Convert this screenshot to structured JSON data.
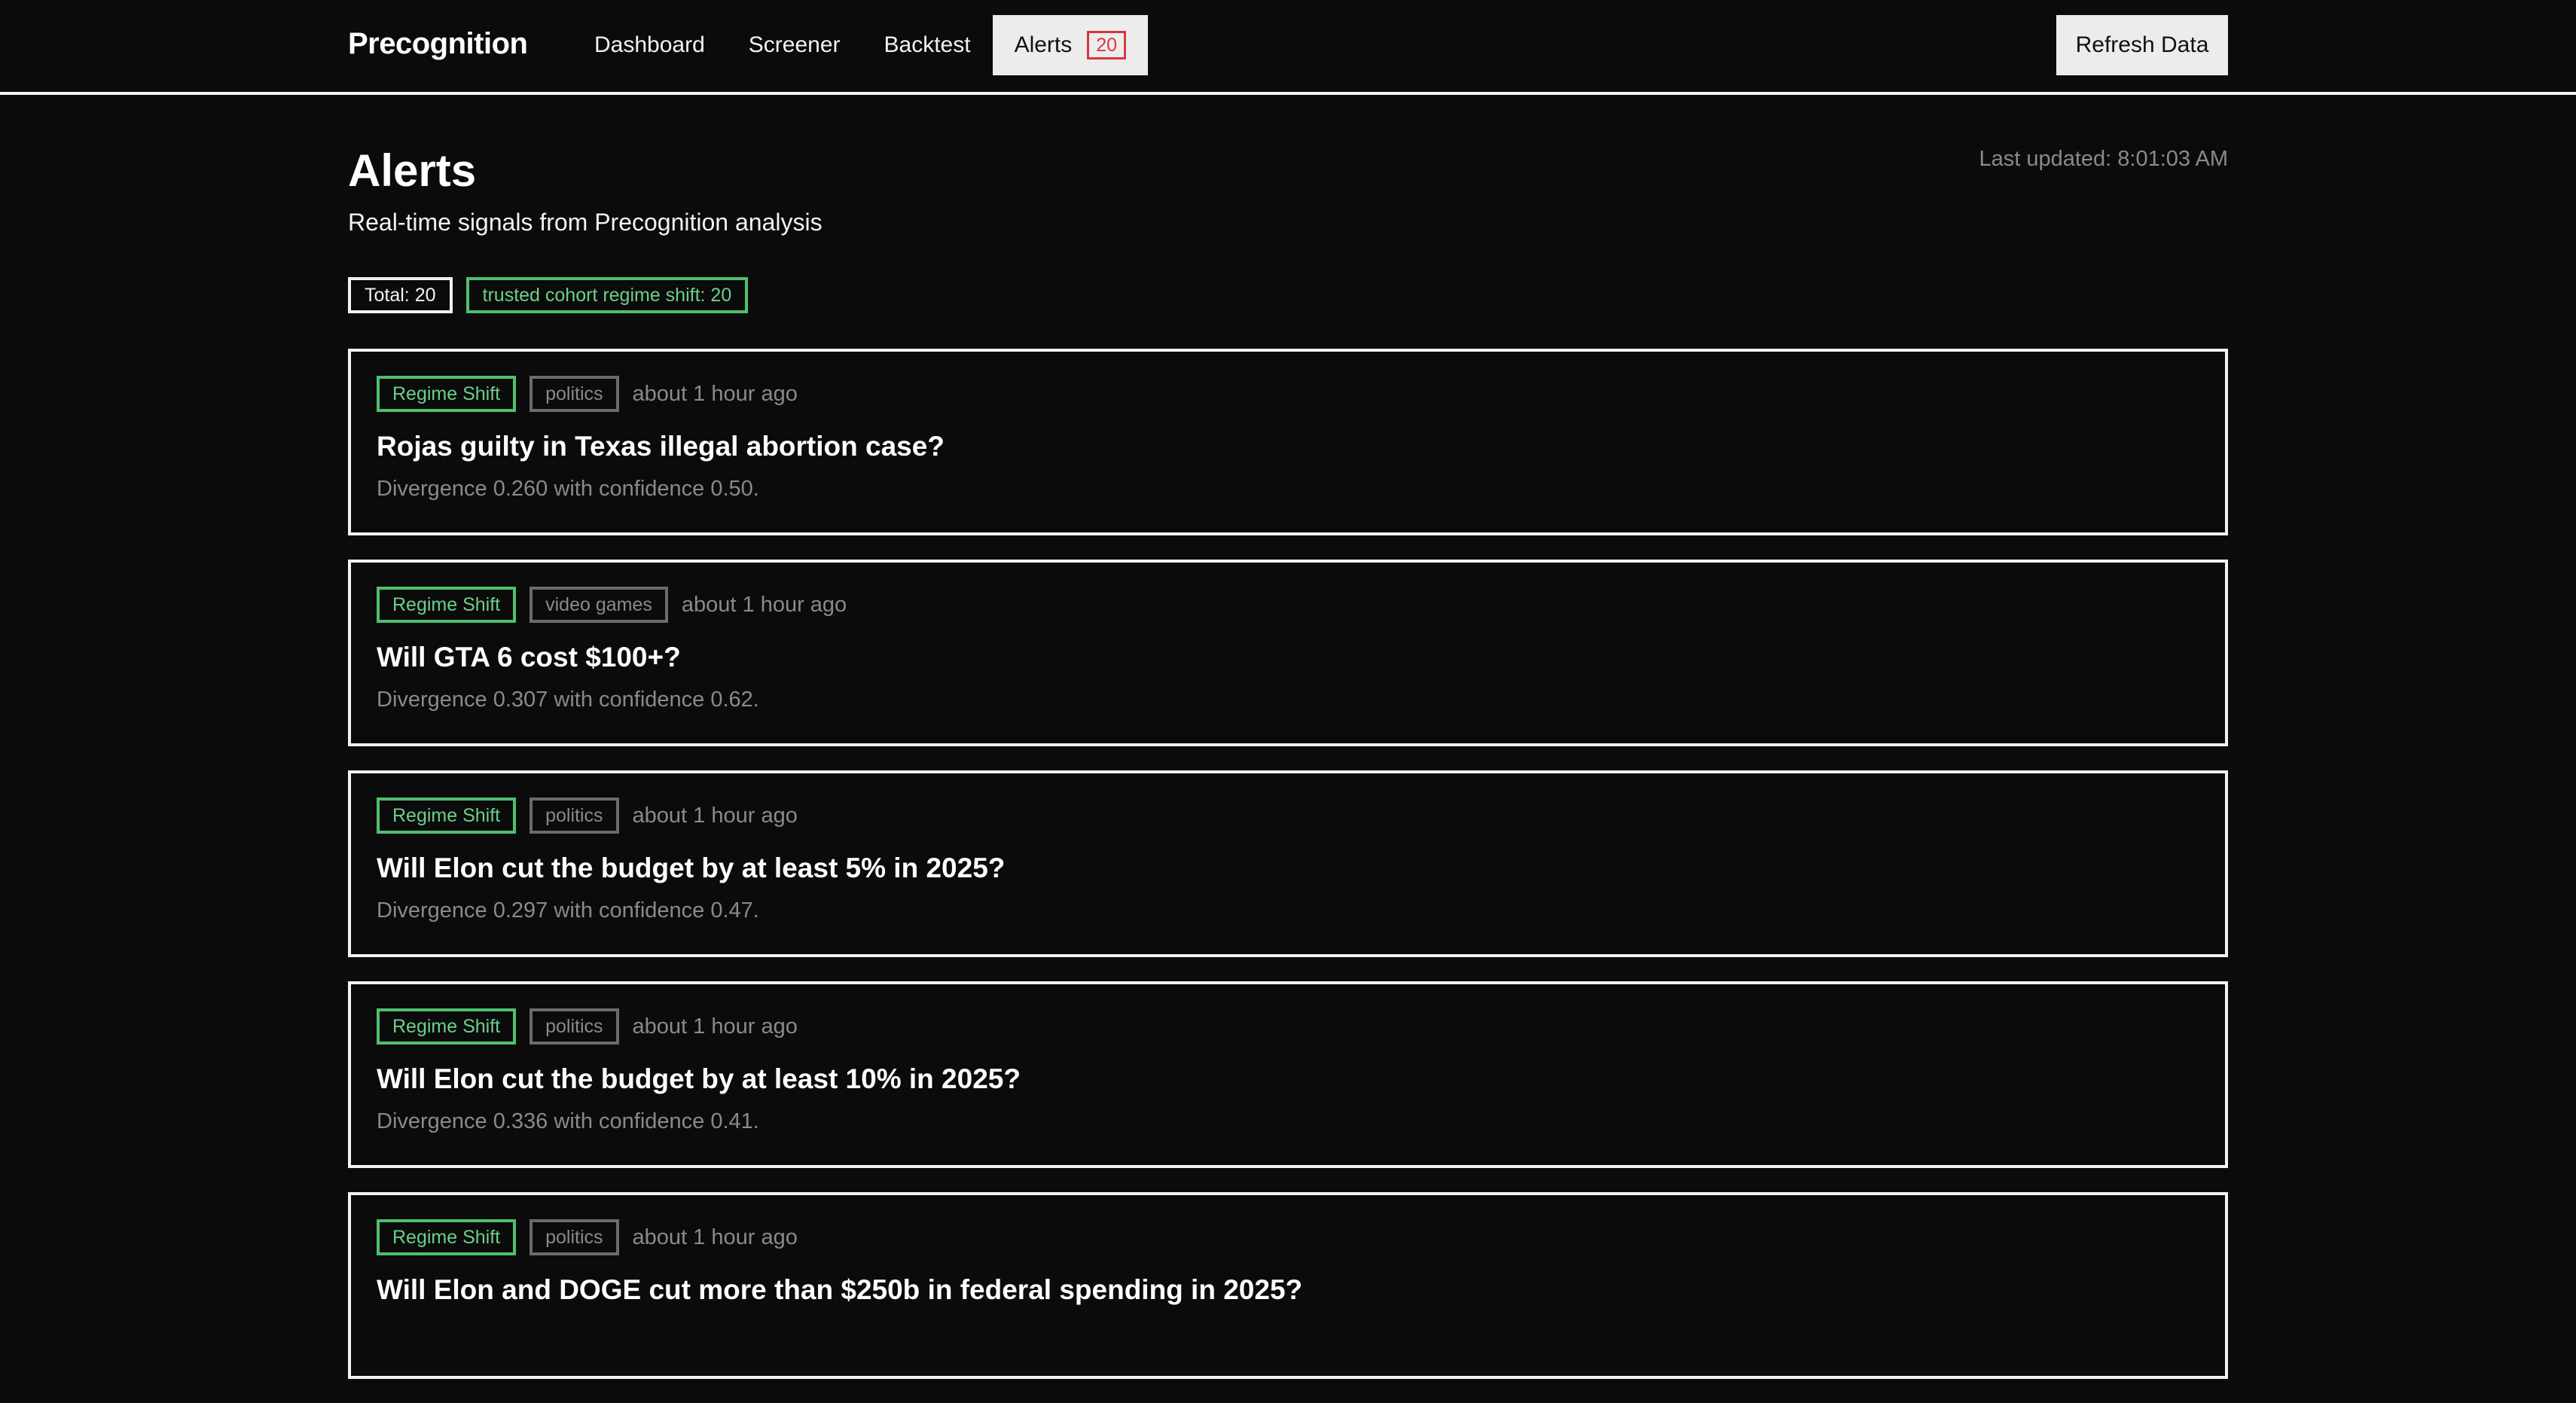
{
  "brand": "Precognition",
  "nav": {
    "items": [
      "Dashboard",
      "Screener",
      "Backtest",
      "Alerts"
    ],
    "alerts_badge": "20"
  },
  "refresh_label": "Refresh Data",
  "page": {
    "title": "Alerts",
    "subtitle": "Real-time signals from Precognition analysis",
    "last_updated": "Last updated: 8:01:03 AM"
  },
  "summary": {
    "total": "Total: 20",
    "regime": "trusted cohort regime shift: 20"
  },
  "colors": {
    "background": "#0b0b0b",
    "accent_green": "#4fbf6e",
    "badge_red": "#d9373d"
  },
  "alerts": [
    {
      "type": "Regime Shift",
      "category": "politics",
      "time": "about 1 hour ago",
      "title": "Rojas guilty in Texas illegal abortion case?",
      "desc": "Divergence 0.260 with confidence 0.50."
    },
    {
      "type": "Regime Shift",
      "category": "video games",
      "time": "about 1 hour ago",
      "title": "Will GTA 6 cost $100+?",
      "desc": "Divergence 0.307 with confidence 0.62."
    },
    {
      "type": "Regime Shift",
      "category": "politics",
      "time": "about 1 hour ago",
      "title": "Will Elon cut the budget by at least 5% in 2025?",
      "desc": "Divergence 0.297 with confidence 0.47."
    },
    {
      "type": "Regime Shift",
      "category": "politics",
      "time": "about 1 hour ago",
      "title": "Will Elon cut the budget by at least 10% in 2025?",
      "desc": "Divergence 0.336 with confidence 0.41."
    },
    {
      "type": "Regime Shift",
      "category": "politics",
      "time": "about 1 hour ago",
      "title": "Will Elon and DOGE cut more than $250b in federal spending in 2025?",
      "desc": ""
    }
  ]
}
